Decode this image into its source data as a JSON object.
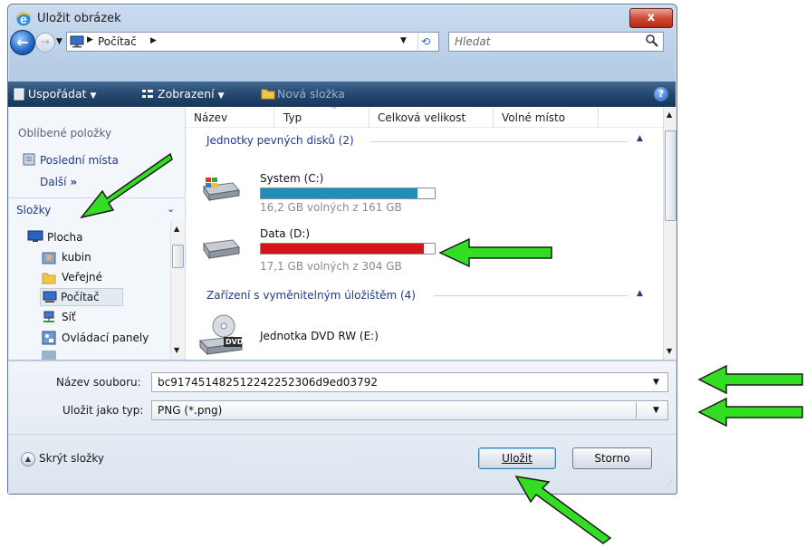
{
  "window": {
    "title": "Uložit obrázek",
    "close_label": "x"
  },
  "nav": {
    "address_crumb": "Počítač",
    "search_placeholder": "Hledat"
  },
  "toolbar": {
    "organize": "Uspořádat",
    "views": "Zobrazení",
    "new_folder": "Nová složka",
    "help": "?"
  },
  "sidebar": {
    "favorites_title": "Oblíbené položky",
    "favorites": [
      {
        "label": "Poslední místa"
      }
    ],
    "more_label": "Další",
    "folders_title": "Složky",
    "tree": [
      {
        "label": "Plocha",
        "icon": "desktop-icon"
      },
      {
        "label": "kubin",
        "icon": "user-folder-icon"
      },
      {
        "label": "Veřejné",
        "icon": "public-folder-icon"
      },
      {
        "label": "Počítač",
        "icon": "computer-icon",
        "selected": true
      },
      {
        "label": "Síť",
        "icon": "network-icon"
      },
      {
        "label": "Ovládací panely",
        "icon": "control-panel-icon"
      }
    ]
  },
  "columns": [
    {
      "label": "Název"
    },
    {
      "label": "Typ"
    },
    {
      "label": "Celková velikost"
    },
    {
      "label": "Volné místo"
    }
  ],
  "groups": [
    {
      "title": "Jednotky pevných disků (2)"
    },
    {
      "title": "Zařízení s vyměnitelným úložištěm (4)"
    }
  ],
  "drives": [
    {
      "name": "System (C:)",
      "free_text": "16,2 GB volných z 161 GB",
      "used_fraction": 0.9,
      "bar_color": "#1e8fb8"
    },
    {
      "name": "Data (D:)",
      "free_text": "17,1 GB volných z 304 GB",
      "used_fraction": 0.94,
      "bar_color": "#d4141b"
    }
  ],
  "removable": [
    {
      "name": "Jednotka DVD RW (E:)",
      "icon_text": "DVD"
    }
  ],
  "form": {
    "filename_label": "Název souboru:",
    "filename_value": "bc917451482512242252306d9ed03792",
    "filetype_label": "Uložit jako typ:",
    "filetype_value": "PNG (*.png)"
  },
  "footer": {
    "hide_folders": "Skrýt složky",
    "save_button": "Uložit",
    "cancel_button": "Storno"
  },
  "colors": {
    "annotation_arrow": "#33dd22",
    "accent": "#1f64c4"
  }
}
